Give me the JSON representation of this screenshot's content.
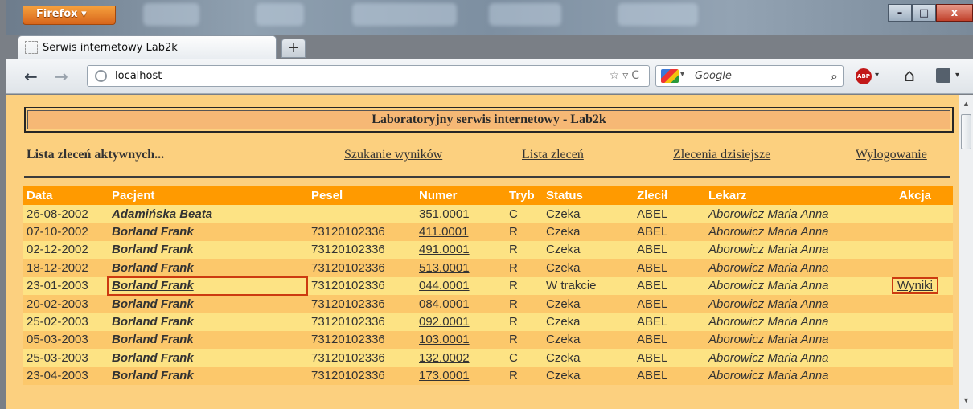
{
  "browser": {
    "app_button": "Firefox",
    "tab_title": "Serwis internetowy Lab2k",
    "new_tab": "+",
    "url": "localhost",
    "search_placeholder": "Google",
    "window_controls": {
      "minimize": "–",
      "maximize": "□",
      "close": "x"
    }
  },
  "page": {
    "header": "Laboratoryjny serwis internetowy - Lab2k",
    "menu": {
      "current": "Lista zleceń aktywnych...",
      "search": "Szukanie wyników",
      "orders": "Lista zleceń",
      "today": "Zlecenia dzisiejsze",
      "logout": "Wylogowanie"
    },
    "table": {
      "headers": [
        "Data",
        "Pacjent",
        "Pesel",
        "Numer",
        "Tryb",
        "Status",
        "Zlecił",
        "Lekarz",
        "Akcja"
      ],
      "rows": [
        {
          "data": "26-08-2002",
          "pacjent": "Adamińska Beata",
          "pesel": "",
          "numer": "351.0001",
          "tryb": "C",
          "status": "Czeka",
          "zlecil": "ABEL",
          "lekarz": "Aborowicz Maria Anna",
          "akcja": ""
        },
        {
          "data": "07-10-2002",
          "pacjent": "Borland Frank",
          "pesel": "73120102336",
          "numer": "411.0001",
          "tryb": "R",
          "status": "Czeka",
          "zlecil": "ABEL",
          "lekarz": "Aborowicz Maria Anna",
          "akcja": ""
        },
        {
          "data": "02-12-2002",
          "pacjent": "Borland Frank",
          "pesel": "73120102336",
          "numer": "491.0001",
          "tryb": "R",
          "status": "Czeka",
          "zlecil": "ABEL",
          "lekarz": "Aborowicz Maria Anna",
          "akcja": ""
        },
        {
          "data": "18-12-2002",
          "pacjent": "Borland Frank",
          "pesel": "73120102336",
          "numer": "513.0001",
          "tryb": "R",
          "status": "Czeka",
          "zlecil": "ABEL",
          "lekarz": "Aborowicz Maria Anna",
          "akcja": ""
        },
        {
          "data": "23-01-2003",
          "pacjent": "Borland Frank",
          "pesel": "73120102336",
          "numer": "044.0001",
          "tryb": "R",
          "status": "W trakcie",
          "zlecil": "ABEL",
          "lekarz": "Aborowicz Maria Anna",
          "akcja": "Wyniki"
        },
        {
          "data": "20-02-2003",
          "pacjent": "Borland Frank",
          "pesel": "73120102336",
          "numer": "084.0001",
          "tryb": "R",
          "status": "Czeka",
          "zlecil": "ABEL",
          "lekarz": "Aborowicz Maria Anna",
          "akcja": ""
        },
        {
          "data": "25-02-2003",
          "pacjent": "Borland Frank",
          "pesel": "73120102336",
          "numer": "092.0001",
          "tryb": "R",
          "status": "Czeka",
          "zlecil": "ABEL",
          "lekarz": "Aborowicz Maria Anna",
          "akcja": ""
        },
        {
          "data": "05-03-2003",
          "pacjent": "Borland Frank",
          "pesel": "73120102336",
          "numer": "103.0001",
          "tryb": "R",
          "status": "Czeka",
          "zlecil": "ABEL",
          "lekarz": "Aborowicz Maria Anna",
          "akcja": ""
        },
        {
          "data": "25-03-2003",
          "pacjent": "Borland Frank",
          "pesel": "73120102336",
          "numer": "132.0002",
          "tryb": "C",
          "status": "Czeka",
          "zlecil": "ABEL",
          "lekarz": "Aborowicz Maria Anna",
          "akcja": ""
        },
        {
          "data": "23-04-2003",
          "pacjent": "Borland Frank",
          "pesel": "73120102336",
          "numer": "173.0001",
          "tryb": "R",
          "status": "Czeka",
          "zlecil": "ABEL",
          "lekarz": "Aborowicz Maria Anna",
          "akcja": ""
        }
      ]
    }
  },
  "colors": {
    "page_background": "#fcd07f",
    "table_header": "#ff9a00",
    "row_odd": "#fde384",
    "row_even": "#fcc86b",
    "highlight_box": "#cc3a10"
  }
}
